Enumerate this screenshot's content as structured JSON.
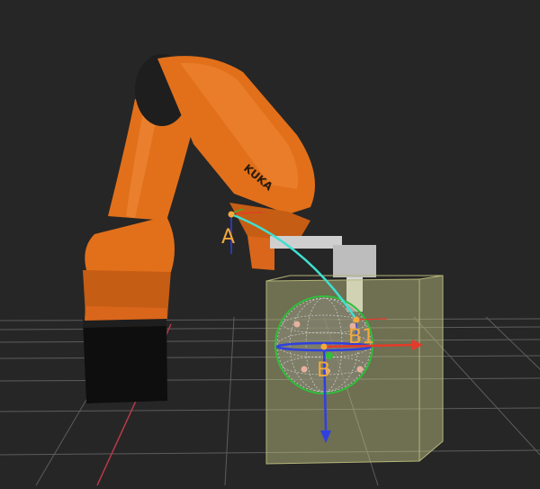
{
  "scene": {
    "background_color": "#262626",
    "grid_color": "#6a6a6a",
    "robot": {
      "brand_label": "KUKA",
      "body_color": "#e2701a",
      "joint_cap_color": "#1e1e1e",
      "pedestal_color": "#0e0e0e"
    },
    "workspace_box_color": "#c9c98a",
    "path_color": "#3fe0d0",
    "axis_colors": {
      "x": "#e53a2a",
      "y": "#2fbf3a",
      "z": "#3040e0"
    },
    "points": {
      "a": {
        "label": "A",
        "color": "#f3a93b"
      },
      "b": {
        "label": "B",
        "color": "#f3a93b"
      },
      "b1": {
        "label": "B1",
        "color": "#f3a93b"
      }
    }
  }
}
